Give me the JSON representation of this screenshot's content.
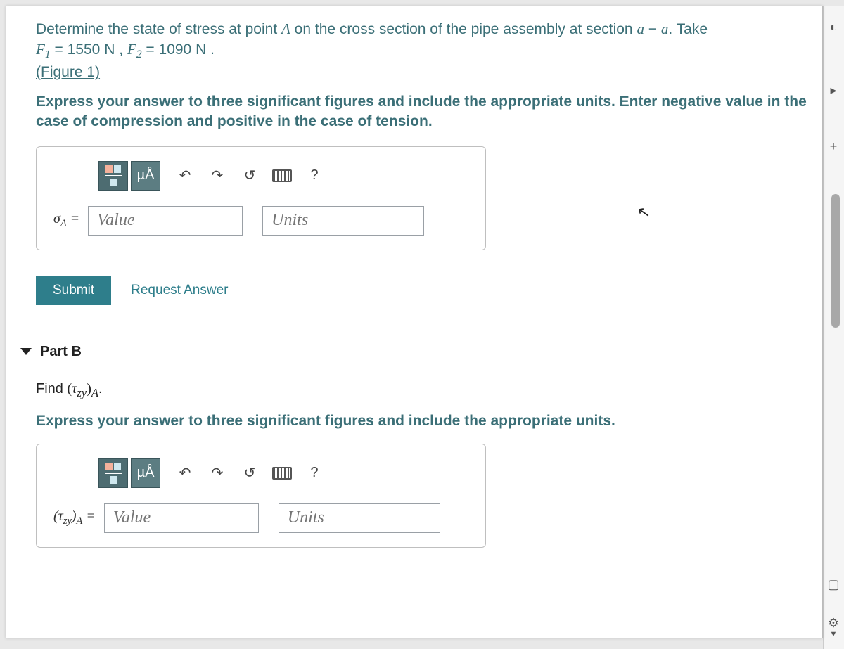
{
  "problem": {
    "line1_a": "Determine the state of stress at point ",
    "pointA": "A",
    "line1_b": " on the cross section of the pipe assembly at section ",
    "sec1": "a",
    "dash": " − ",
    "sec2": "a",
    "line1_c": ". Take",
    "F1_label": "F",
    "F1_sub": "1",
    "F1_eq": " = 1550 ",
    "F1_unit": "N",
    "comma": " , ",
    "F2_label": "F",
    "F2_sub": "2",
    "F2_eq": " = 1090 ",
    "F2_unit": "N",
    "period": " .",
    "figure_link": "(Figure 1)"
  },
  "instruction_a": "Express your answer to three significant figures and include the appropriate units. Enter negative value in the case of compression and positive in the case of tension.",
  "toolbar": {
    "muA": "µÅ",
    "undo": "↶",
    "redo": "↷",
    "reset": "↺",
    "help": "?"
  },
  "answer_a": {
    "label_sym": "σ",
    "label_sub": "A",
    "label_eq": " =",
    "value_ph": "Value",
    "units_ph": "Units"
  },
  "submit_label": "Submit",
  "request_label": "Request Answer",
  "part_b_label": "Part B",
  "find_text_a": "Find ",
  "find_tau": "τ",
  "find_sub": "zy",
  "find_paren_close_sub": "A",
  "find_period": ".",
  "instruction_b": "Express your answer to three significant figures and include the appropriate units.",
  "answer_b": {
    "label_tau": "τ",
    "label_sub1": "zy",
    "label_sub2": "A",
    "label_eq": " =",
    "value_ph": "Value",
    "units_ph": "Units"
  }
}
